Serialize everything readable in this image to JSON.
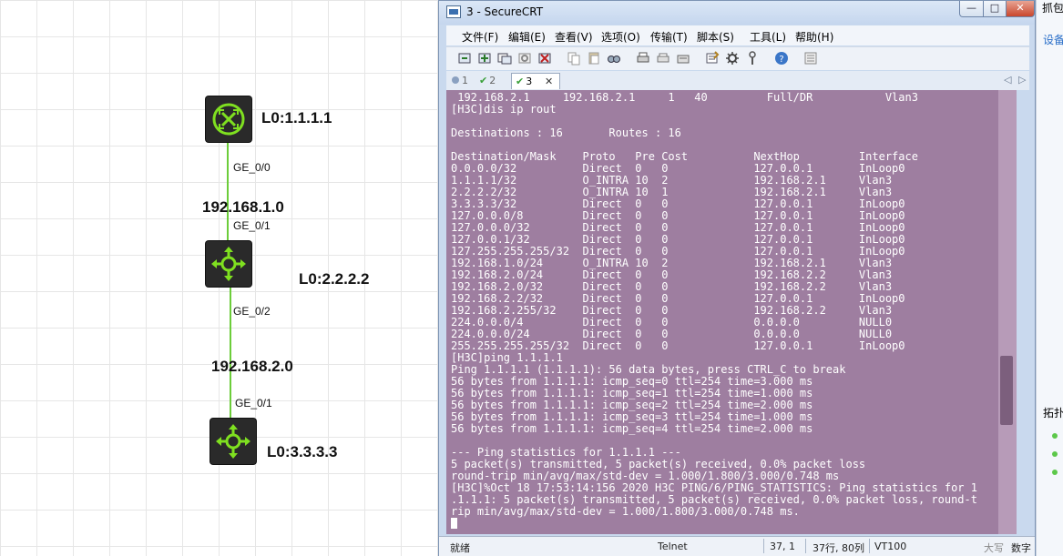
{
  "topology": {
    "routers": [
      {
        "loopback": "L0:1.1.1.1"
      },
      {
        "loopback": "L0:2.2.2.2"
      },
      {
        "loopback": "L0:3.3.3.3"
      }
    ],
    "networks": [
      "192.168.1.0",
      "192.168.2.0"
    ],
    "ports": {
      "r1_down": "GE_0/0",
      "r2_up": "GE_0/1",
      "r2_down": "GE_0/2",
      "r3_up": "GE_0/1"
    }
  },
  "peek": {
    "top_label": "抓包",
    "link_label": "设备",
    "side_label": "拓扑"
  },
  "window": {
    "title": "3 - SecureCRT",
    "min_glyph": "—",
    "max_glyph": "□",
    "close_glyph": "✕"
  },
  "menu": [
    "文件(F)",
    "编辑(E)",
    "查看(V)",
    "选项(O)",
    "传输(T)",
    "脚本(S)",
    "工具(L)",
    "帮助(H)"
  ],
  "tabs": [
    {
      "label": "1",
      "status": "disconnected"
    },
    {
      "label": "2",
      "status": "connected"
    },
    {
      "label": "3",
      "status": "connected",
      "active": true
    }
  ],
  "tab_close_glyph": "✕",
  "tab_nav": {
    "left": "◁",
    "right": "▷"
  },
  "terminal": {
    "lines": [
      " 192.168.2.1     192.168.2.1     1   40         Full/DR           Vlan3",
      "[H3C]dis ip rout",
      "",
      "Destinations : 16       Routes : 16",
      "",
      "Destination/Mask    Proto   Pre Cost          NextHop         Interface",
      "0.0.0.0/32          Direct  0   0             127.0.0.1       InLoop0",
      "1.1.1.1/32          O_INTRA 10  2             192.168.2.1     Vlan3",
      "2.2.2.2/32          O_INTRA 10  1             192.168.2.1     Vlan3",
      "3.3.3.3/32          Direct  0   0             127.0.0.1       InLoop0",
      "127.0.0.0/8         Direct  0   0             127.0.0.1       InLoop0",
      "127.0.0.0/32        Direct  0   0             127.0.0.1       InLoop0",
      "127.0.0.1/32        Direct  0   0             127.0.0.1       InLoop0",
      "127.255.255.255/32  Direct  0   0             127.0.0.1       InLoop0",
      "192.168.1.0/24      O_INTRA 10  2             192.168.2.1     Vlan3",
      "192.168.2.0/24      Direct  0   0             192.168.2.2     Vlan3",
      "192.168.2.0/32      Direct  0   0             192.168.2.2     Vlan3",
      "192.168.2.2/32      Direct  0   0             127.0.0.1       InLoop0",
      "192.168.2.255/32    Direct  0   0             192.168.2.2     Vlan3",
      "224.0.0.0/4         Direct  0   0             0.0.0.0         NULL0",
      "224.0.0.0/24        Direct  0   0             0.0.0.0         NULL0",
      "255.255.255.255/32  Direct  0   0             127.0.0.1       InLoop0",
      "[H3C]ping 1.1.1.1",
      "Ping 1.1.1.1 (1.1.1.1): 56 data bytes, press CTRL_C to break",
      "56 bytes from 1.1.1.1: icmp_seq=0 ttl=254 time=3.000 ms",
      "56 bytes from 1.1.1.1: icmp_seq=1 ttl=254 time=1.000 ms",
      "56 bytes from 1.1.1.1: icmp_seq=2 ttl=254 time=2.000 ms",
      "56 bytes from 1.1.1.1: icmp_seq=3 ttl=254 time=1.000 ms",
      "56 bytes from 1.1.1.1: icmp_seq=4 ttl=254 time=2.000 ms",
      "",
      "--- Ping statistics for 1.1.1.1 ---",
      "5 packet(s) transmitted, 5 packet(s) received, 0.0% packet loss",
      "round-trip min/avg/max/std-dev = 1.000/1.800/3.000/0.748 ms",
      "[H3C]%Oct 18 17:53:14:156 2020 H3C PING/6/PING_STATISTICS: Ping statistics for 1",
      ".1.1.1: 5 packet(s) transmitted, 5 packet(s) received, 0.0% packet loss, round-t",
      "rip min/avg/max/std-dev = 1.000/1.800/3.000/0.748 ms."
    ]
  },
  "status": {
    "ready": "就绪",
    "protocol": "Telnet",
    "cursor_pos": "37,  1",
    "rows_cols": "37行, 80列",
    "terminal_type": "VT100",
    "caps": "大写",
    "num": "数字"
  },
  "colors": {
    "terminal_bg": "#9e7ea0",
    "link": "#6ccd3a",
    "device_green": "#7fe020"
  }
}
